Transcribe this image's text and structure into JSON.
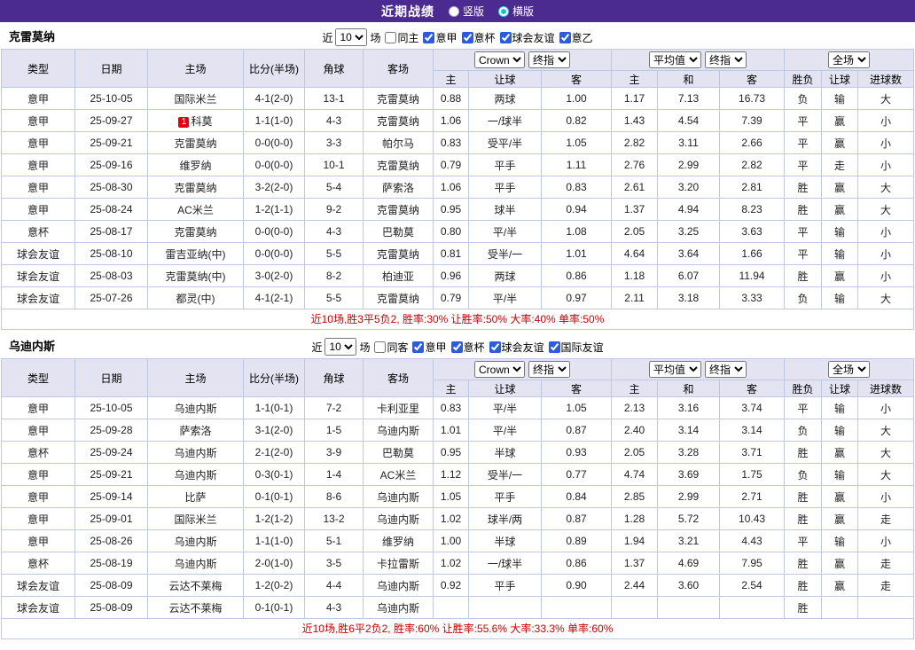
{
  "palette": {
    "topbar_bg": "#4b2b8f",
    "serie_a_bg": "#1777d3",
    "cup_bg": "#4343d8",
    "friendly_bg": "#2c9c9c",
    "table_header_bg": "#e3e3f1",
    "table_border": "#bfc8e2",
    "win_red": "#e30013",
    "lose_blue": "#0a0ad0",
    "push_green": "#009933",
    "score_red": "#cc0000",
    "corner_blue": "#1515cc",
    "home_focal_green": "#009900",
    "away_focal_red": "#cc0000",
    "summary_red": "#cc0000",
    "radio_selected_cyan": "#19c0dd"
  },
  "topbar": {
    "title": "近期战绩",
    "vertical_label": "竖版",
    "horizontal_label": "横版",
    "selected": "横版"
  },
  "table_header": {
    "type": "类型",
    "date": "日期",
    "home": "主场",
    "score": "比分(半场)",
    "corner": "角球",
    "away": "客场",
    "sub": [
      "主",
      "让球",
      "客",
      "主",
      "和",
      "客",
      "胜负",
      "让球",
      "进球数"
    ]
  },
  "sections": [
    {
      "team": "克雷莫纳",
      "focal_color": "green",
      "filter": {
        "near": "近",
        "count": "10",
        "games": "场",
        "checkboxes": [
          {
            "label": "同主",
            "checked": false
          },
          {
            "label": "意甲",
            "checked": true
          },
          {
            "label": "意杯",
            "checked": true
          },
          {
            "label": "球会友谊",
            "checked": true
          },
          {
            "label": "意乙",
            "checked": true
          }
        ]
      },
      "selects": {
        "odds_source": "Crown",
        "odds_point": "终指",
        "avg_source": "平均值",
        "avg_point": "终指",
        "scope": "全场"
      },
      "rows": [
        {
          "type": "意甲",
          "date": "25-10-05",
          "home": "国际米兰",
          "home_focal": false,
          "score": "4-1(2-0)",
          "corner": "13-1",
          "away": "克雷莫纳",
          "away_focal": true,
          "odds": [
            "0.88",
            "两球",
            "1.00"
          ],
          "avg": [
            "1.17",
            "7.13",
            "16.73"
          ],
          "result": "负",
          "handicap": "输",
          "goals": "大"
        },
        {
          "type": "意甲",
          "date": "25-09-27",
          "home": "科莫",
          "home_badge": "1",
          "home_focal": false,
          "score": "1-1(1-0)",
          "corner": "4-3",
          "away": "克雷莫纳",
          "away_focal": true,
          "odds": [
            "1.06",
            "一/球半",
            "0.82"
          ],
          "avg": [
            "1.43",
            "4.54",
            "7.39"
          ],
          "result": "平",
          "handicap": "赢",
          "goals": "小"
        },
        {
          "type": "意甲",
          "date": "25-09-21",
          "home": "克雷莫纳",
          "home_focal": true,
          "score": "0-0(0-0)",
          "corner": "3-3",
          "away": "帕尔马",
          "away_focal": false,
          "odds": [
            "0.83",
            "受平/半",
            "1.05"
          ],
          "avg": [
            "2.82",
            "3.11",
            "2.66"
          ],
          "result": "平",
          "handicap": "赢",
          "goals": "小"
        },
        {
          "type": "意甲",
          "date": "25-09-16",
          "home": "维罗纳",
          "home_focal": false,
          "score": "0-0(0-0)",
          "corner": "10-1",
          "away": "克雷莫纳",
          "away_focal": true,
          "odds": [
            "0.79",
            "平手",
            "1.11"
          ],
          "avg": [
            "2.76",
            "2.99",
            "2.82"
          ],
          "result": "平",
          "handicap": "走",
          "goals": "小"
        },
        {
          "type": "意甲",
          "date": "25-08-30",
          "home": "克雷莫纳",
          "home_focal": true,
          "score": "3-2(2-0)",
          "corner": "5-4",
          "away": "萨索洛",
          "away_focal": false,
          "odds": [
            "1.06",
            "平手",
            "0.83"
          ],
          "avg": [
            "2.61",
            "3.20",
            "2.81"
          ],
          "result": "胜",
          "handicap": "赢",
          "goals": "大"
        },
        {
          "type": "意甲",
          "date": "25-08-24",
          "home": "AC米兰",
          "home_focal": false,
          "score": "1-2(1-1)",
          "corner": "9-2",
          "away": "克雷莫纳",
          "away_focal": true,
          "odds": [
            "0.95",
            "球半",
            "0.94"
          ],
          "avg": [
            "1.37",
            "4.94",
            "8.23"
          ],
          "result": "胜",
          "handicap": "赢",
          "goals": "大"
        },
        {
          "type": "意杯",
          "date": "25-08-17",
          "home": "克雷莫纳",
          "home_focal": true,
          "score": "0-0(0-0)",
          "corner": "4-3",
          "away": "巴勒莫",
          "away_focal": false,
          "odds": [
            "0.80",
            "平/半",
            "1.08"
          ],
          "avg": [
            "2.05",
            "3.25",
            "3.63"
          ],
          "result": "平",
          "handicap": "输",
          "goals": "小"
        },
        {
          "type": "球会友谊",
          "date": "25-08-10",
          "home": "雷吉亚纳(中)",
          "home_focal": false,
          "score": "0-0(0-0)",
          "corner": "5-5",
          "away": "克雷莫纳",
          "away_focal": true,
          "odds": [
            "0.81",
            "受半/一",
            "1.01"
          ],
          "avg": [
            "4.64",
            "3.64",
            "1.66"
          ],
          "result": "平",
          "handicap": "输",
          "goals": "小"
        },
        {
          "type": "球会友谊",
          "date": "25-08-03",
          "home": "克雷莫纳(中)",
          "home_focal": true,
          "score": "3-0(2-0)",
          "corner": "8-2",
          "away": "柏迪亚",
          "away_focal": false,
          "odds": [
            "0.96",
            "两球",
            "0.86"
          ],
          "avg": [
            "1.18",
            "6.07",
            "11.94"
          ],
          "result": "胜",
          "handicap": "赢",
          "goals": "小"
        },
        {
          "type": "球会友谊",
          "date": "25-07-26",
          "home": "都灵(中)",
          "home_focal": false,
          "score": "4-1(2-1)",
          "corner": "5-5",
          "away": "克雷莫纳",
          "away_focal": true,
          "odds": [
            "0.79",
            "平/半",
            "0.97"
          ],
          "avg": [
            "2.11",
            "3.18",
            "3.33"
          ],
          "result": "负",
          "handicap": "输",
          "goals": "大"
        }
      ],
      "summary": "近10场,胜3平5负2, 胜率:30% 让胜率:50% 大率:40% 单率:50%"
    },
    {
      "team": "乌迪内斯",
      "focal_color": "red",
      "filter": {
        "near": "近",
        "count": "10",
        "games": "场",
        "checkboxes": [
          {
            "label": "同客",
            "checked": false
          },
          {
            "label": "意甲",
            "checked": true
          },
          {
            "label": "意杯",
            "checked": true
          },
          {
            "label": "球会友谊",
            "checked": true
          },
          {
            "label": "国际友谊",
            "checked": true
          }
        ]
      },
      "selects": {
        "odds_source": "Crown",
        "odds_point": "终指",
        "avg_source": "平均值",
        "avg_point": "终指",
        "scope": "全场"
      },
      "rows": [
        {
          "type": "意甲",
          "date": "25-10-05",
          "home": "乌迪内斯",
          "home_focal": true,
          "score": "1-1(0-1)",
          "corner": "7-2",
          "away": "卡利亚里",
          "away_focal": false,
          "odds": [
            "0.83",
            "平/半",
            "1.05"
          ],
          "avg": [
            "2.13",
            "3.16",
            "3.74"
          ],
          "result": "平",
          "handicap": "输",
          "goals": "小"
        },
        {
          "type": "意甲",
          "date": "25-09-28",
          "home": "萨索洛",
          "home_focal": false,
          "score": "3-1(2-0)",
          "corner": "1-5",
          "away": "乌迪内斯",
          "away_focal": true,
          "odds": [
            "1.01",
            "平/半",
            "0.87"
          ],
          "avg": [
            "2.40",
            "3.14",
            "3.14"
          ],
          "result": "负",
          "handicap": "输",
          "goals": "大"
        },
        {
          "type": "意杯",
          "date": "25-09-24",
          "home": "乌迪内斯",
          "home_focal": true,
          "score": "2-1(2-0)",
          "corner": "3-9",
          "away": "巴勒莫",
          "away_focal": false,
          "odds": [
            "0.95",
            "半球",
            "0.93"
          ],
          "avg": [
            "2.05",
            "3.28",
            "3.71"
          ],
          "result": "胜",
          "handicap": "赢",
          "goals": "大"
        },
        {
          "type": "意甲",
          "date": "25-09-21",
          "home": "乌迪内斯",
          "home_focal": true,
          "score": "0-3(0-1)",
          "corner": "1-4",
          "away": "AC米兰",
          "away_focal": false,
          "odds": [
            "1.12",
            "受半/一",
            "0.77"
          ],
          "avg": [
            "4.74",
            "3.69",
            "1.75"
          ],
          "result": "负",
          "handicap": "输",
          "goals": "大"
        },
        {
          "type": "意甲",
          "date": "25-09-14",
          "home": "比萨",
          "home_focal": false,
          "score": "0-1(0-1)",
          "corner": "8-6",
          "away": "乌迪内斯",
          "away_focal": true,
          "odds": [
            "1.05",
            "平手",
            "0.84"
          ],
          "avg": [
            "2.85",
            "2.99",
            "2.71"
          ],
          "result": "胜",
          "handicap": "赢",
          "goals": "小"
        },
        {
          "type": "意甲",
          "date": "25-09-01",
          "home": "国际米兰",
          "home_focal": false,
          "score": "1-2(1-2)",
          "corner": "13-2",
          "away": "乌迪内斯",
          "away_focal": true,
          "odds": [
            "1.02",
            "球半/两",
            "0.87"
          ],
          "avg": [
            "1.28",
            "5.72",
            "10.43"
          ],
          "result": "胜",
          "handicap": "赢",
          "goals": "走"
        },
        {
          "type": "意甲",
          "date": "25-08-26",
          "home": "乌迪内斯",
          "home_focal": true,
          "score": "1-1(1-0)",
          "corner": "5-1",
          "away": "维罗纳",
          "away_focal": false,
          "odds": [
            "1.00",
            "半球",
            "0.89"
          ],
          "avg": [
            "1.94",
            "3.21",
            "4.43"
          ],
          "result": "平",
          "handicap": "输",
          "goals": "小"
        },
        {
          "type": "意杯",
          "date": "25-08-19",
          "home": "乌迪内斯",
          "home_focal": true,
          "score": "2-0(1-0)",
          "corner": "3-5",
          "away": "卡拉雷斯",
          "away_focal": false,
          "odds": [
            "1.02",
            "一/球半",
            "0.86"
          ],
          "avg": [
            "1.37",
            "4.69",
            "7.95"
          ],
          "result": "胜",
          "handicap": "赢",
          "goals": "走"
        },
        {
          "type": "球会友谊",
          "date": "25-08-09",
          "home": "云达不莱梅",
          "home_focal": false,
          "score": "1-2(0-2)",
          "corner": "4-4",
          "away": "乌迪内斯",
          "away_focal": true,
          "odds": [
            "0.92",
            "平手",
            "0.90"
          ],
          "avg": [
            "2.44",
            "3.60",
            "2.54"
          ],
          "result": "胜",
          "handicap": "赢",
          "goals": "走"
        },
        {
          "type": "球会友谊",
          "date": "25-08-09",
          "home": "云达不莱梅",
          "home_focal": false,
          "score": "0-1(0-1)",
          "corner": "4-3",
          "away": "乌迪内斯",
          "away_focal": true,
          "odds": [
            "",
            "",
            ""
          ],
          "avg": [
            "",
            "",
            ""
          ],
          "result": "胜",
          "handicap": "",
          "goals": ""
        }
      ],
      "summary": "近10场,胜6平2负2, 胜率:60% 让胜率:55.6% 大率:33.3% 单率:60%"
    }
  ]
}
